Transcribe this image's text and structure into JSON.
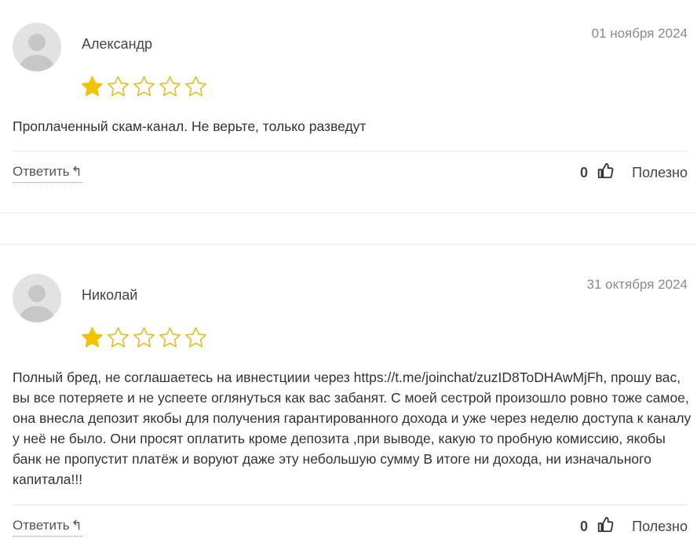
{
  "reviews": [
    {
      "author": "Александр",
      "date": "01 ноября 2024",
      "rating": 1,
      "max_rating": 5,
      "text": "Проплаченный скам-канал. Не верьте, только разведут",
      "reply_label": "Ответить",
      "reply_arrow": "↰",
      "useful_count": "0",
      "useful_label": "Полезно"
    },
    {
      "author": "Николай",
      "date": "31 октября 2024",
      "rating": 1,
      "max_rating": 5,
      "text": "Полный бред, не соглашаетесь на ивнестциии через https://t.me/joinchat/zuzID8ToDHAwMjFh, прошу вас, вы все потеряете и не успеете оглянуться как вас забанят. С моей сестрой произошло ровно тоже самое, она внесла депозит якобы для получения гарантированного дохода и уже через неделю доступа к каналу у неё не было. Они просят оплатить кроме депозита ,при выводе, какую то пробную комиссию, якобы банк не пропустит платёж и воруют даже эту небольшую сумму В итоге ни дохода, ни изначального капитала!!!",
      "reply_label": "Ответить",
      "reply_arrow": "↰",
      "useful_count": "0",
      "useful_label": "Полезно"
    }
  ],
  "colors": {
    "star_filled": "#f2c200",
    "star_outline": "#e8bf2a",
    "divider": "#e9e9e9",
    "avatar_bg": "#e4e4e4"
  }
}
